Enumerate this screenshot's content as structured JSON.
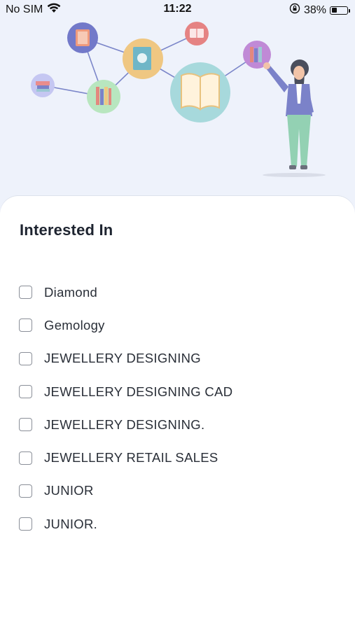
{
  "status_bar": {
    "carrier": "No SIM",
    "time": "11:22",
    "battery_percent": "38%",
    "battery_level": 0.38,
    "icons": [
      "wifi-icon",
      "orientation-lock-icon",
      "battery-icon"
    ]
  },
  "illustration": {
    "description_icons": [
      "books-icon",
      "open-book-icon",
      "teacher-figure"
    ]
  },
  "section": {
    "title": "Interested In"
  },
  "options": [
    {
      "label": "Diamond",
      "checked": false
    },
    {
      "label": "Gemology",
      "checked": false
    },
    {
      "label": "JEWELLERY DESIGNING",
      "checked": false
    },
    {
      "label": "JEWELLERY DESIGNING CAD",
      "checked": false
    },
    {
      "label": "JEWELLERY DESIGNING.",
      "checked": false
    },
    {
      "label": "JEWELLERY RETAIL SALES",
      "checked": false
    },
    {
      "label": "JUNIOR",
      "checked": false
    },
    {
      "label": "JUNIOR.",
      "checked": false
    }
  ],
  "colors": {
    "background": "#eef2fb",
    "sheet": "#ffffff",
    "checkbox_border": "#8a8f98",
    "text": "#2a2f38"
  }
}
